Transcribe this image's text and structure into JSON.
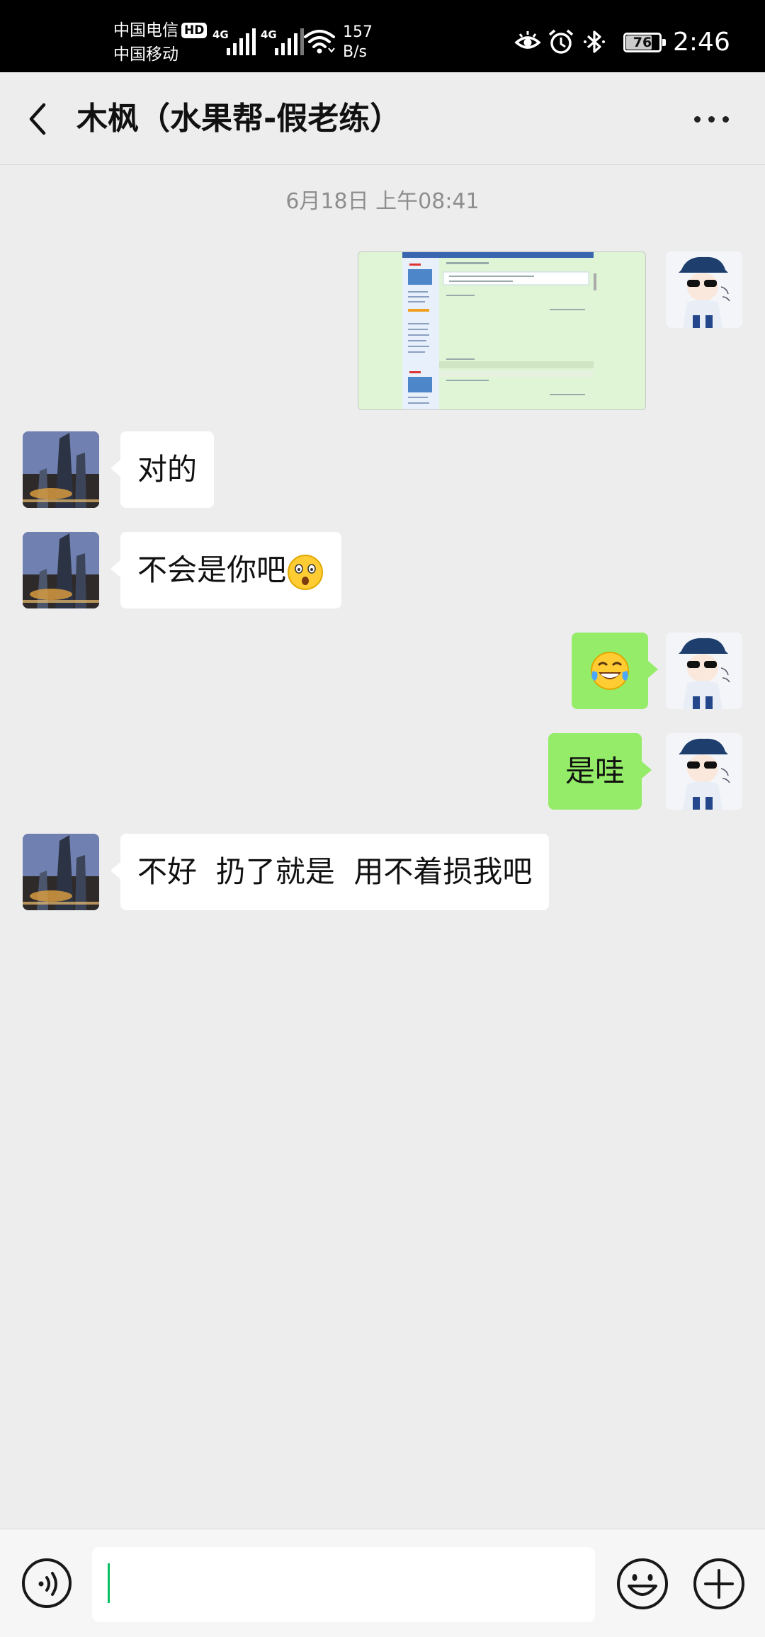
{
  "status_bar": {
    "carrier1": "中国电信",
    "hd_badge": "HD",
    "carrier2": "中国移动",
    "network1": "4G",
    "network2": "4G",
    "speed_value": "157",
    "speed_unit": "B/s",
    "battery": "76",
    "time": "2:46",
    "icons": [
      "eye-icon",
      "alarm-icon",
      "bluetooth-icon",
      "battery-icon"
    ]
  },
  "header": {
    "title": "木枫（水果帮-假老练）",
    "back_icon": "chevron-left-icon",
    "more_icon": "more-dots-icon"
  },
  "messages": [
    {
      "type": "timestamp",
      "text": "6月18日 上午08:41"
    },
    {
      "side": "right",
      "kind": "image",
      "content": "forum screenshot"
    },
    {
      "side": "left",
      "kind": "text",
      "text": "对的"
    },
    {
      "side": "left",
      "kind": "text",
      "text": "不会是你吧",
      "emoji": "astonished-face-emoji"
    },
    {
      "side": "right",
      "kind": "emoji",
      "emoji": "tears-of-joy-emoji"
    },
    {
      "side": "right",
      "kind": "text",
      "text": "是哇"
    },
    {
      "side": "left",
      "kind": "text",
      "text": "不好  扔了就是  用不着损我吧"
    }
  ],
  "input_bar": {
    "voice_icon": "voice-icon",
    "input_value": "",
    "emoji_icon": "emoji-icon",
    "plus_icon": "plus-icon"
  },
  "colors": {
    "background": "#ededed",
    "outgoing_bubble": "#95ec69",
    "incoming_bubble": "#ffffff",
    "caret": "#07c160"
  }
}
